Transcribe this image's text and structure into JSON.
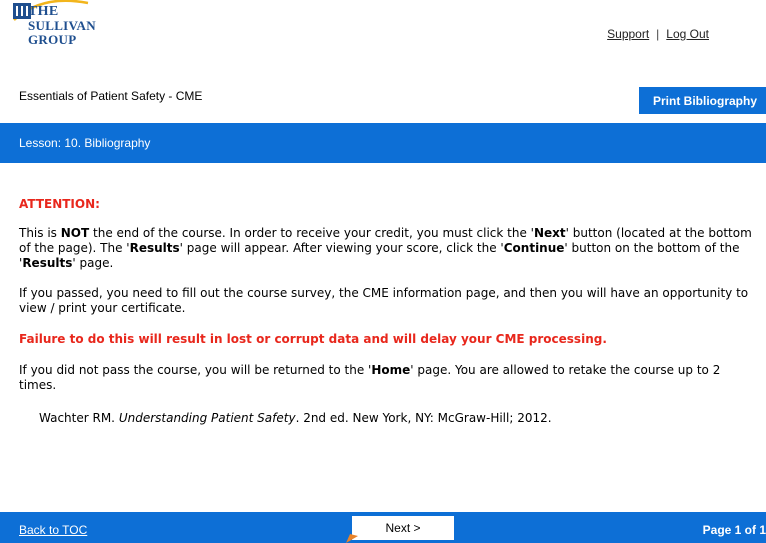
{
  "header": {
    "logo": {
      "line1": "THE",
      "line2": "SULLIVAN",
      "line3": "GROUP"
    },
    "links": {
      "support": "Support",
      "separator": "|",
      "logout": "Log Out"
    },
    "course_title": "Essentials of Patient Safety - CME",
    "print_button": "Print Bibliography",
    "lesson": "Lesson: 10. Bibliography"
  },
  "content": {
    "attention_heading": "ATTENTION:",
    "p1": {
      "t1": "This is ",
      "b1": "NOT",
      "t2": " the end of the course. In order to receive your credit, you must click the '",
      "b2": "Next",
      "t3": "' button (located at the bottom of the page). The '",
      "b3": "Results",
      "t4": "' page will appear. After viewing your score, click the '",
      "b4": "Continue",
      "t5": "' button on the bottom of the '",
      "b5": "Results",
      "t6": "' page."
    },
    "p2": "If you passed, you need to fill out the course survey, the CME information page, and then you will have an opportunity to view / print your certificate.",
    "warning": "Failure to do this will result in lost or corrupt data and will delay your CME processing.",
    "p3": {
      "t1": "If you did not pass the course, you will be returned to the '",
      "b1": "Home",
      "t2": "' page. You are allowed to retake the course up to 2 times."
    },
    "bibliography": {
      "author": "Wachter RM. ",
      "title": "Understanding Patient Safety",
      "rest": ". 2nd ed. New York, NY: McGraw-Hill; 2012."
    }
  },
  "footer": {
    "back_link": "Back to TOC",
    "next_button": "Next  >",
    "page_indicator": "Page 1 of 1"
  },
  "colors": {
    "brand_blue": "#0d6fd6",
    "logo_blue": "#1f4f8f",
    "logo_gold": "#f2b51c",
    "attention_red": "#e8271c"
  }
}
